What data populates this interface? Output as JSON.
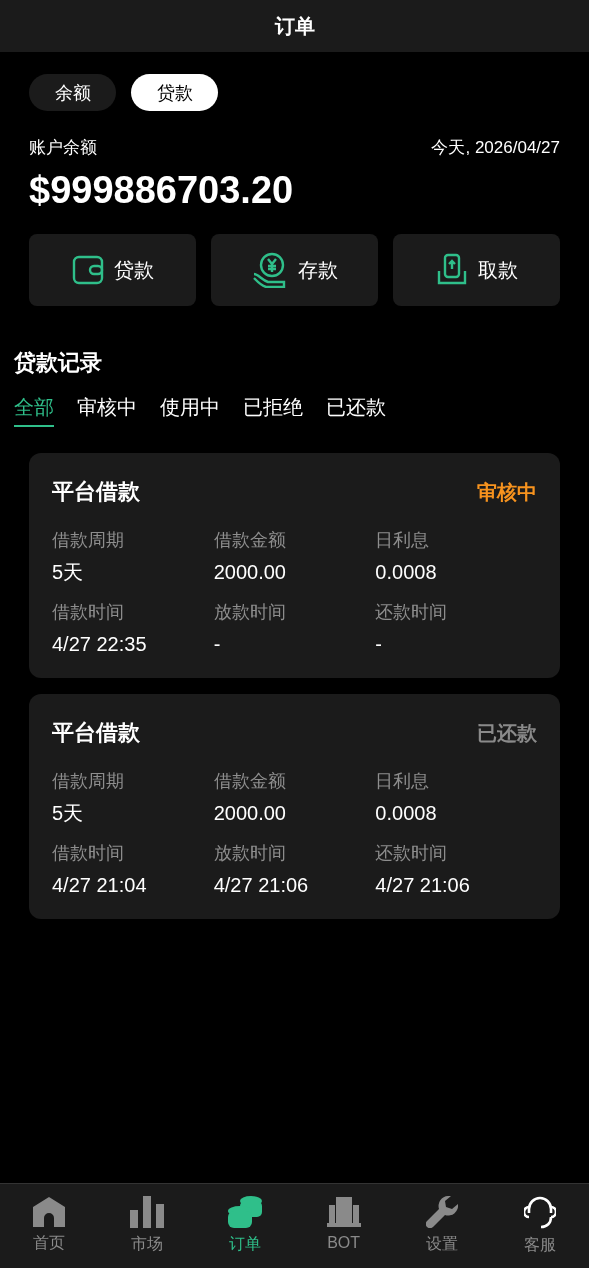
{
  "header": {
    "title": "订单"
  },
  "mode_tabs": [
    {
      "label": "余额",
      "selected": false
    },
    {
      "label": "贷款",
      "selected": true
    }
  ],
  "account": {
    "label": "账户余额",
    "date": "今天, 2026/04/27",
    "balance": "$999886703.20"
  },
  "actions": [
    {
      "kind": "wallet",
      "label": "贷款"
    },
    {
      "kind": "deposit",
      "label": "存款"
    },
    {
      "kind": "withdraw",
      "label": "取款"
    }
  ],
  "records": {
    "title": "贷款记录",
    "filters": [
      {
        "label": "全部",
        "selected": true
      },
      {
        "label": "审核中",
        "selected": false
      },
      {
        "label": "使用中",
        "selected": false
      },
      {
        "label": "已拒绝",
        "selected": false
      },
      {
        "label": "已还款",
        "selected": false
      }
    ],
    "loans": [
      {
        "name": "平台借款",
        "status": "审核中",
        "color": "#f7931e",
        "fields": [
          {
            "label": "借款周期",
            "value": "5天"
          },
          {
            "label": "借款金额",
            "value": "2000.00"
          },
          {
            "label": "日利息",
            "value": "0.0008"
          },
          {
            "label": "借款时间",
            "value": "4/27 22:35"
          },
          {
            "label": "放款时间",
            "value": "-"
          },
          {
            "label": "还款时间",
            "value": "-"
          }
        ]
      },
      {
        "name": "平台借款",
        "status": "已还款",
        "color": "#8a8a8a",
        "fields": [
          {
            "label": "借款周期",
            "value": "5天"
          },
          {
            "label": "借款金额",
            "value": "2000.00"
          },
          {
            "label": "日利息",
            "value": "0.0008"
          },
          {
            "label": "借款时间",
            "value": "4/27 21:04"
          },
          {
            "label": "放款时间",
            "value": "4/27 21:06"
          },
          {
            "label": "还款时间",
            "value": "4/27 21:06"
          }
        ]
      }
    ]
  },
  "nav": [
    {
      "kind": "home",
      "label": "首页",
      "selected": false
    },
    {
      "kind": "market",
      "label": "市场",
      "selected": false
    },
    {
      "kind": "orders",
      "label": "订单",
      "selected": true
    },
    {
      "kind": "bot",
      "label": "BOT",
      "selected": false
    },
    {
      "kind": "settings",
      "label": "设置",
      "selected": false
    },
    {
      "kind": "support",
      "label": "客服",
      "selected": false
    }
  ]
}
